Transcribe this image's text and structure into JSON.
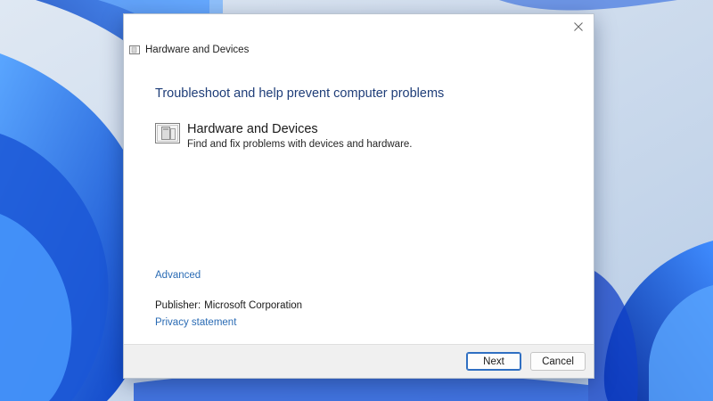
{
  "window": {
    "title": "Hardware and Devices",
    "close_icon": "close-icon"
  },
  "main": {
    "heading": "Troubleshoot and help prevent computer problems",
    "item": {
      "icon": "hardware-devices-icon",
      "title": "Hardware and Devices",
      "description": "Find and fix problems with devices and hardware."
    },
    "advanced_label": "Advanced",
    "publisher_label": "Publisher:",
    "publisher_value": "Microsoft Corporation",
    "privacy_label": "Privacy statement"
  },
  "footer": {
    "next_label": "Next",
    "cancel_label": "Cancel"
  },
  "colors": {
    "heading": "#1e3d78",
    "link": "#2a6bb4",
    "desktop_accent": "#1b57d6",
    "focus_border": "#2f6fc2"
  }
}
